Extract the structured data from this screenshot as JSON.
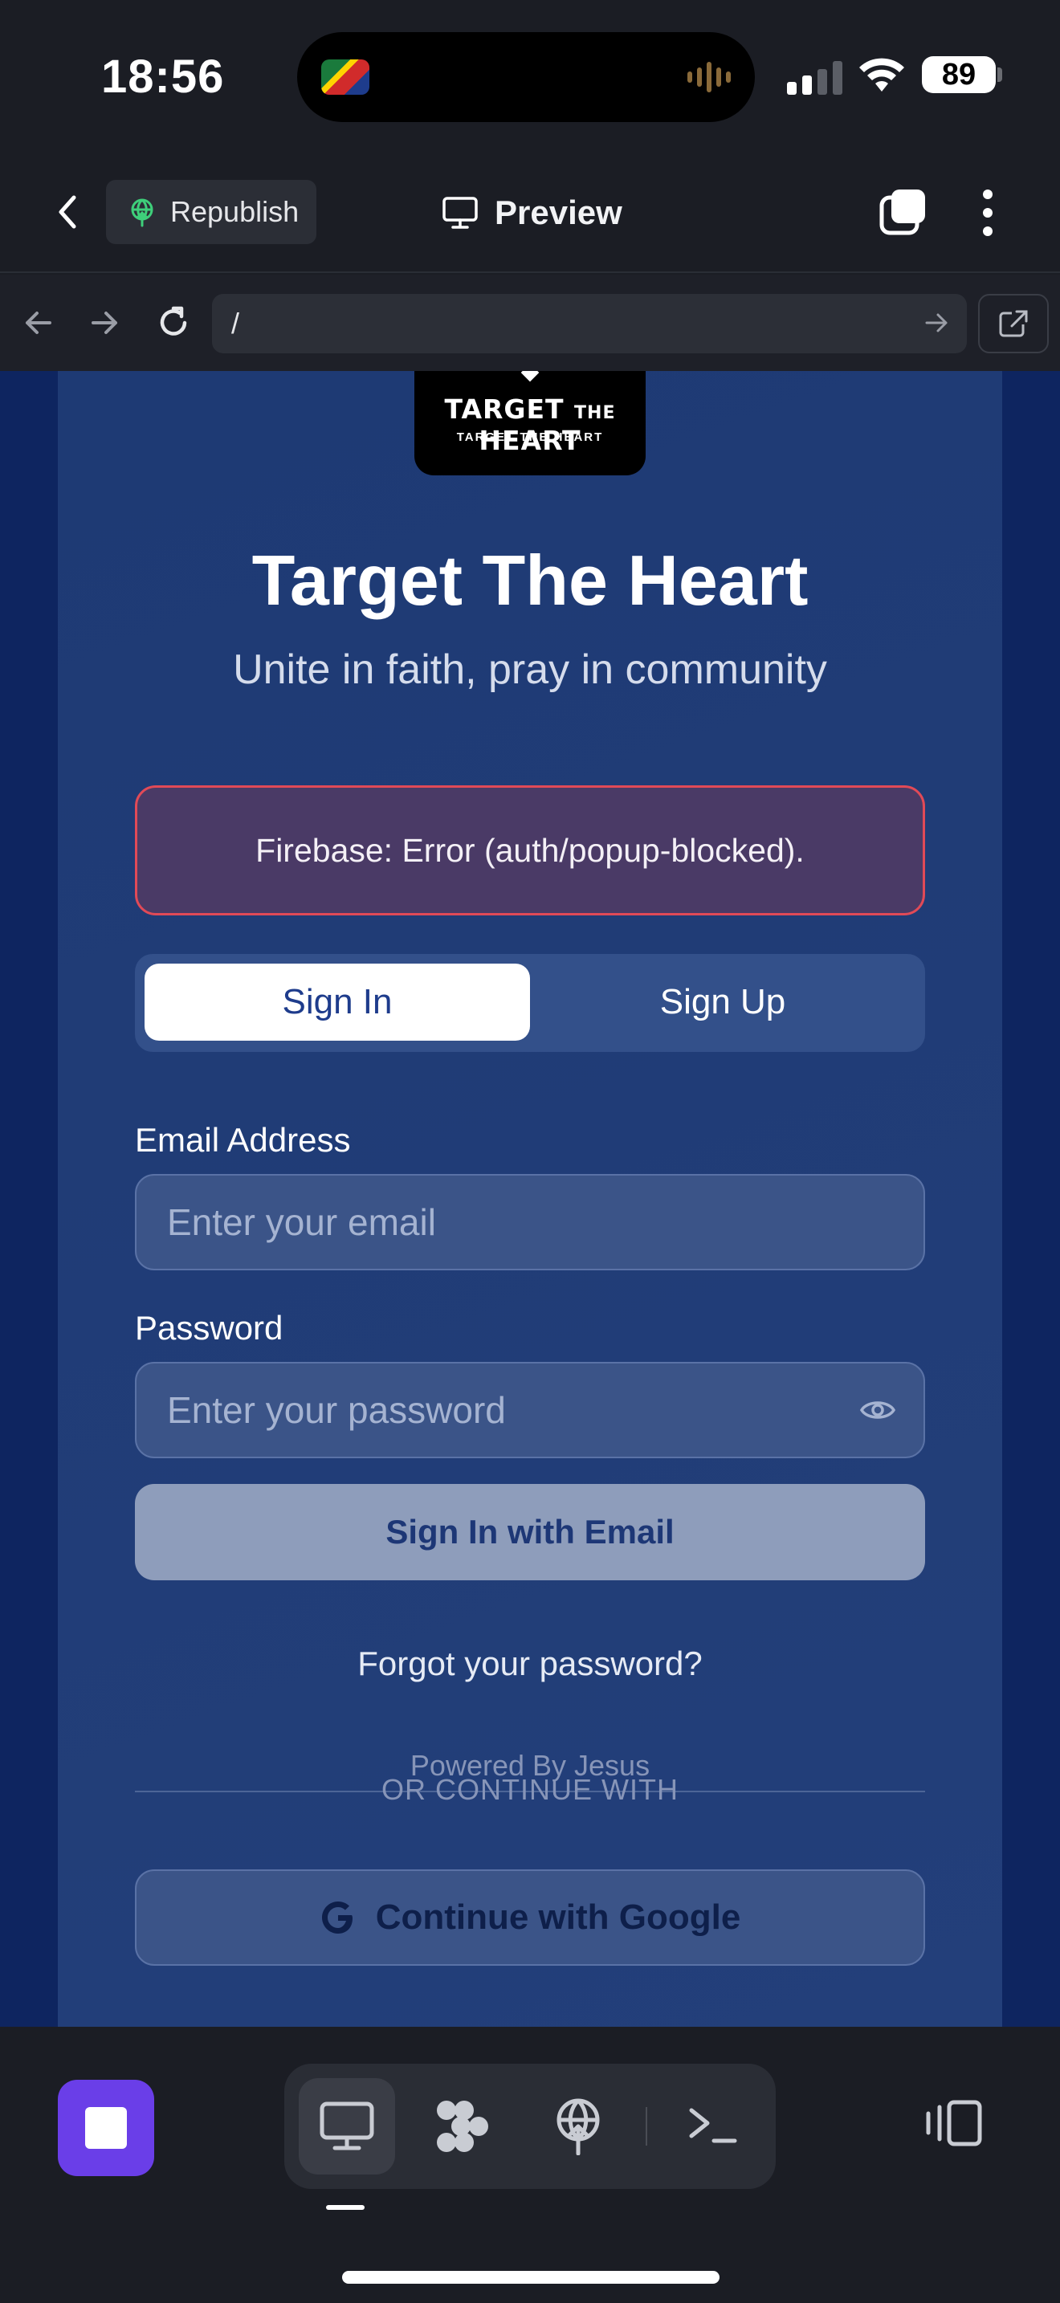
{
  "status_bar": {
    "time": "18:56",
    "battery": "89"
  },
  "toolbar": {
    "republish_label": "Republish",
    "preview_label": "Preview"
  },
  "browser": {
    "url": "/"
  },
  "page": {
    "logo_main": "TARGET",
    "logo_the": "THE",
    "logo_heart": "HEART",
    "logo_sub": "TARGET THE HEART",
    "title": "Target The Heart",
    "subtitle": "Unite in faith, pray in community",
    "error_message": "Firebase: Error (auth/popup-blocked).",
    "tabs": [
      {
        "label": "Sign In",
        "active": true
      },
      {
        "label": "Sign Up",
        "active": false
      }
    ],
    "email_label": "Email Address",
    "email_placeholder": "Enter your email",
    "password_label": "Password",
    "password_placeholder": "Enter your password",
    "submit_label": "Sign In with Email",
    "forgot_label": "Forgot your password?",
    "powered_by": "Powered By Jesus",
    "divider_label": "OR CONTINUE WITH",
    "google_label": "Continue with Google"
  },
  "colors": {
    "page_background": "#0e2560",
    "card_background": "#1e3a74",
    "error_border": "#e14a57",
    "stop_button": "#6a3ee8"
  },
  "icons": {
    "back": "chevron-left-icon",
    "republish": "globe-upload-icon",
    "preview": "monitor-icon",
    "tabs": "tabs-icon",
    "more": "more-vertical-icon",
    "reload": "reload-icon",
    "password_toggle": "eye-icon",
    "google": "google-icon"
  }
}
